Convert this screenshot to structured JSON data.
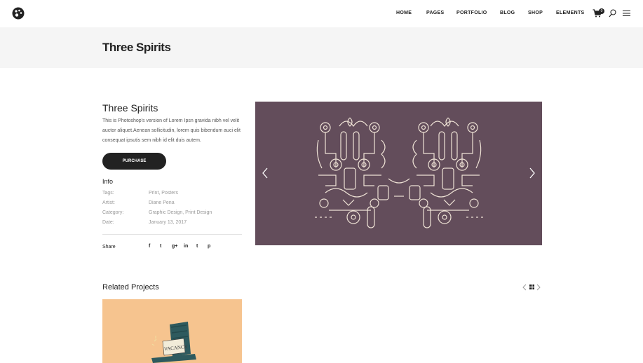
{
  "header": {
    "nav": [
      "HOME",
      "PAGES",
      "PORTFOLIO",
      "BLOG",
      "SHOP",
      "ELEMENTS"
    ],
    "cart_count": "0"
  },
  "page": {
    "title": "Three Spirits"
  },
  "project": {
    "title": "Three Spirits",
    "description": "This is Photoshop's version of Lorem Ipsn gravida nibh vel velit auctor aliquet.Aenean sollicitudin, lorem quis bibendum auci elit consequat ipsutis sem nibh id elit duis autem.",
    "purchase_label": "PURCHASE",
    "info_heading": "Info",
    "info": [
      {
        "label": "Tags:",
        "value": "Print, Posters"
      },
      {
        "label": "Artist:",
        "value": "Diane Pena"
      },
      {
        "label": "Category:",
        "value": "Graphic Design, Print Design"
      },
      {
        "label": "Date:",
        "value": "January 13, 2017"
      }
    ],
    "share_label": "Share",
    "social": [
      "f",
      "t",
      "g+",
      "in",
      "t",
      "p"
    ]
  },
  "gallery": {
    "background": "#634d5b"
  },
  "related": {
    "title": "Related Projects",
    "thumb_text": "VACANCY"
  },
  "colors": {
    "accent": "#222222",
    "band": "#f5f5f5",
    "related_bg": "#f6c48f"
  }
}
